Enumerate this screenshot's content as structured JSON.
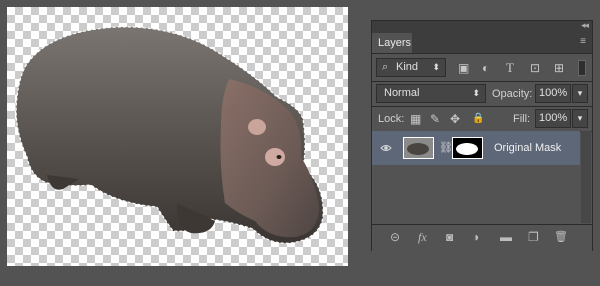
{
  "panel": {
    "collapse_glyph": "◂◂",
    "menu_glyph": "≡",
    "tab_label": "Layers",
    "filter": {
      "label": "Kind",
      "search_glyph": "⌕",
      "arrow": "⬍"
    },
    "filter_icons": [
      "image-filter-icon",
      "adjustment-filter-icon",
      "type-filter-icon",
      "shape-filter-icon",
      "smartobject-filter-icon"
    ],
    "filter_icon_glyphs": [
      "▣",
      "◐",
      "T",
      "⊡",
      "⊞"
    ],
    "blend_mode": "Normal",
    "blend_arrow": "⬍",
    "opacity_label": "Opacity:",
    "opacity_value": "100%",
    "lock_label": "Lock:",
    "fill_label": "Fill:",
    "fill_value": "100%",
    "dropdown_arrow": "▾",
    "lock_glyphs": [
      "▦",
      "✎",
      "✥",
      "🔒"
    ],
    "layer": {
      "name": "Original Mask",
      "chain_glyph": "⛓"
    },
    "bottom_icons": [
      "link-layers-icon",
      "fx-icon",
      "add-mask-icon",
      "adjustment-layer-icon",
      "new-group-icon",
      "new-layer-icon",
      "delete-layer-icon"
    ],
    "bottom_glyphs": [
      "⊝",
      "fx",
      "◙",
      "◑",
      "▬",
      "❐",
      "🗑"
    ]
  },
  "colors": {
    "app_bg": "#535353",
    "panel_dark": "#3d3d3d",
    "selected_layer": "#5e6778"
  }
}
